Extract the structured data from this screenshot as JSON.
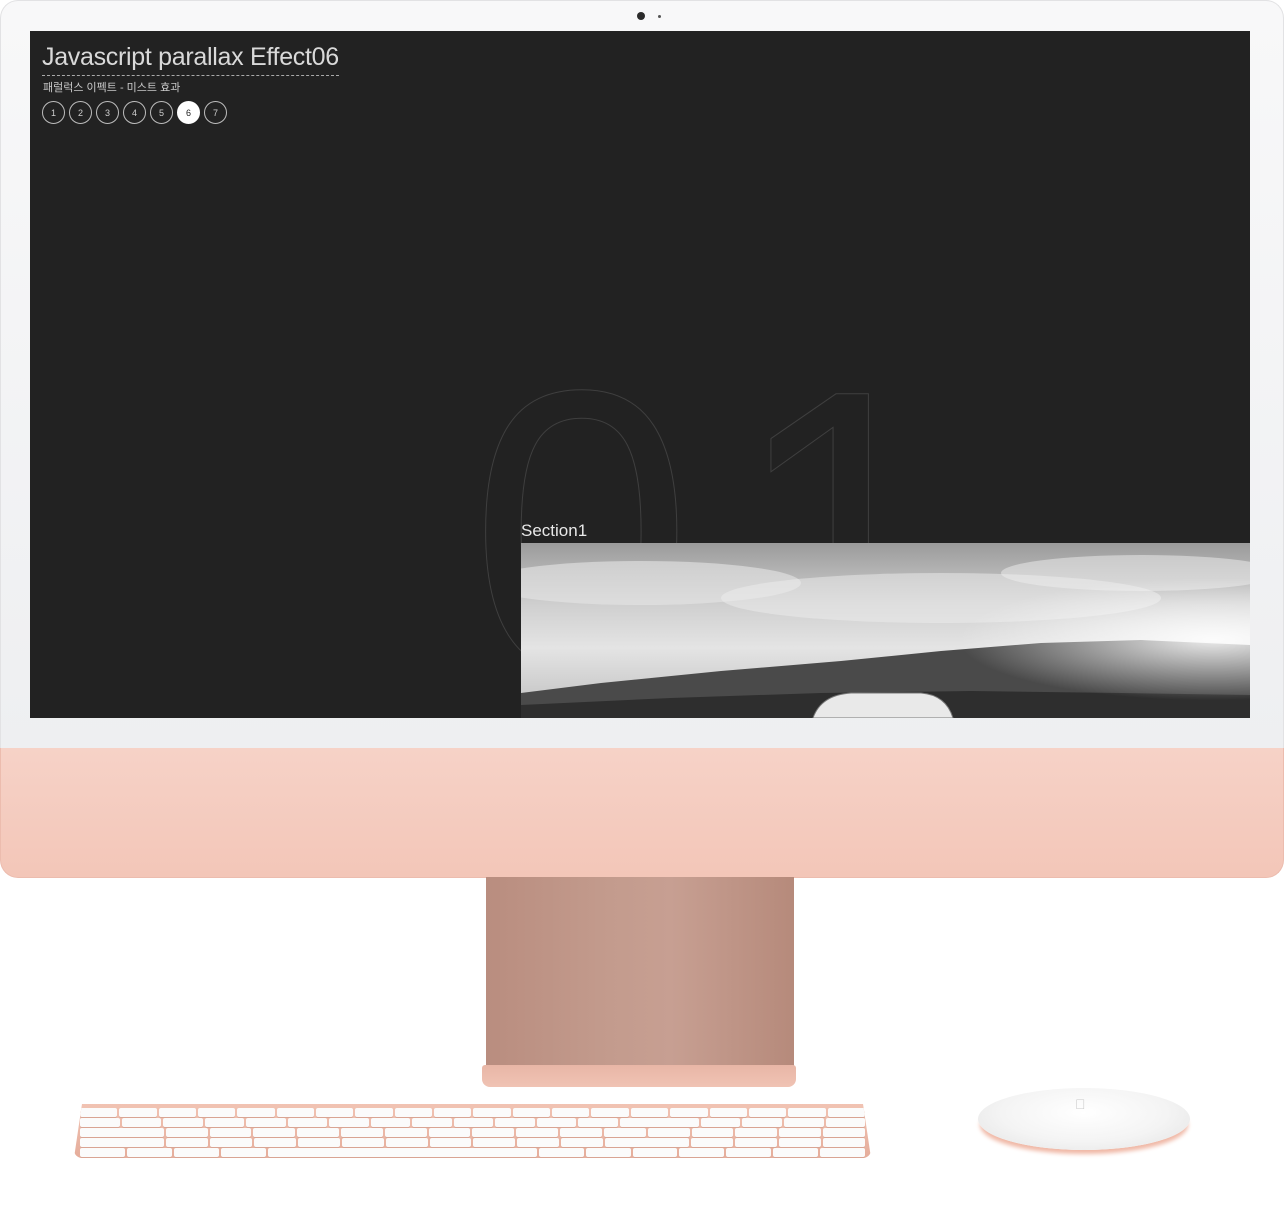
{
  "page": {
    "title": "Javascript parallax Effect06",
    "subtitle": "패럴럭스 이펙트 - 미스트 효과",
    "nav_dots": [
      {
        "label": "1",
        "active": false
      },
      {
        "label": "2",
        "active": false
      },
      {
        "label": "3",
        "active": false
      },
      {
        "label": "4",
        "active": false
      },
      {
        "label": "5",
        "active": false
      },
      {
        "label": "6",
        "active": true
      },
      {
        "label": "7",
        "active": false
      }
    ],
    "section": {
      "number": "01",
      "label": "Section1"
    }
  },
  "device": {
    "frame_color": "#f7f7f8",
    "chin_color": "#f4c9bb",
    "stand_color": "#bf9486",
    "screen_bg": "#222222",
    "mouse_logo": "apple-logo-icon"
  }
}
